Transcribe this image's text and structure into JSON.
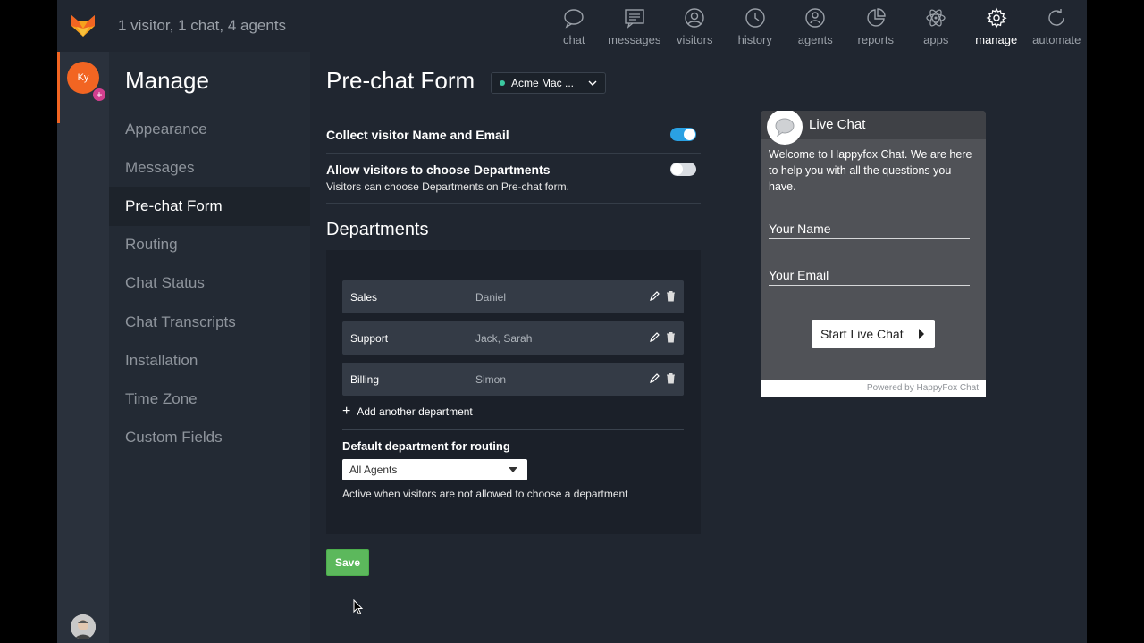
{
  "header": {
    "status": "1 visitor, 1 chat, 4 agents",
    "nav": [
      {
        "label": "chat",
        "icon": "chat-bubble-icon"
      },
      {
        "label": "messages",
        "icon": "messages-icon"
      },
      {
        "label": "visitors",
        "icon": "visitors-icon"
      },
      {
        "label": "history",
        "icon": "history-icon"
      },
      {
        "label": "agents",
        "icon": "agents-icon"
      },
      {
        "label": "reports",
        "icon": "reports-icon"
      },
      {
        "label": "apps",
        "icon": "apps-icon"
      },
      {
        "label": "manage",
        "icon": "gear-icon",
        "active": true
      },
      {
        "label": "automate",
        "icon": "automate-icon"
      }
    ]
  },
  "rail": {
    "avatar_initials": "Ky",
    "avatar_color": "#f26522"
  },
  "sidebar": {
    "title": "Manage",
    "items": [
      {
        "label": "Appearance"
      },
      {
        "label": "Messages"
      },
      {
        "label": "Pre-chat Form",
        "active": true
      },
      {
        "label": "Routing"
      },
      {
        "label": "Chat Status"
      },
      {
        "label": "Chat Transcripts"
      },
      {
        "label": "Installation"
      },
      {
        "label": "Time Zone"
      },
      {
        "label": "Custom Fields"
      }
    ]
  },
  "main": {
    "title": "Pre-chat Form",
    "site_select": "Acme Mac ...",
    "options": {
      "collect": {
        "label": "Collect visitor Name and Email",
        "enabled": true
      },
      "departments": {
        "label": "Allow visitors to choose Departments",
        "sub": "Visitors can choose Departments on Pre-chat form.",
        "enabled": false
      }
    },
    "departments_title": "Departments",
    "departments": [
      {
        "name": "Sales",
        "agents": "Daniel"
      },
      {
        "name": "Support",
        "agents": "Jack, Sarah"
      },
      {
        "name": "Billing",
        "agents": "Simon"
      }
    ],
    "add_department": "Add another department",
    "default_label": "Default department for routing",
    "default_value": "All Agents",
    "default_hint": "Active when visitors are not allowed to choose a department",
    "save": "Save"
  },
  "widget": {
    "title": "Live Chat",
    "welcome": "Welcome to Happyfox Chat. We are here to help you with all the questions you have.",
    "name_placeholder": "Your Name",
    "email_placeholder": "Your Email",
    "start": "Start Live Chat",
    "footer": "Powered by HappyFox Chat"
  },
  "colors": {
    "accent": "#f26522",
    "toggle_on": "#2aa1e3",
    "save": "#5cb85c",
    "online": "#3bc9a0"
  }
}
